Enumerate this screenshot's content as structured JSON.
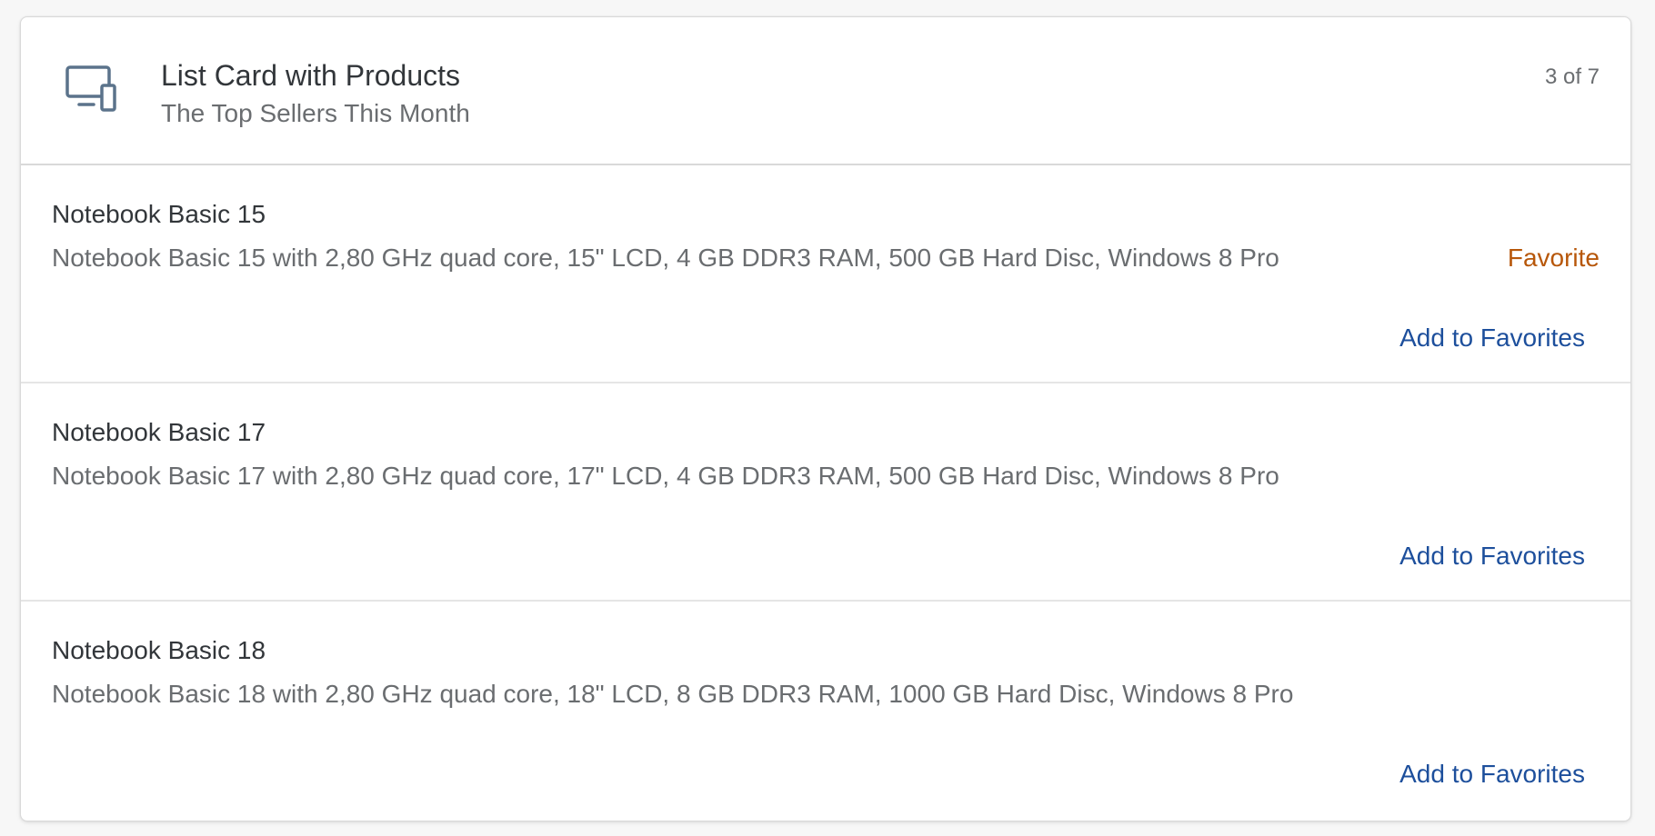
{
  "card": {
    "title": "List Card with Products",
    "subtitle": "The Top Sellers This Month",
    "count": "3 of 7",
    "icon": "laptop-tablet-icon",
    "colors": {
      "icon": "#5b738b",
      "status_favorite": "#b7570a",
      "link": "#1d4f9c"
    }
  },
  "items": [
    {
      "title": "Notebook Basic 15",
      "description": "Notebook Basic 15 with 2,80 GHz quad core, 15\" LCD, 4 GB DDR3 RAM, 500 GB Hard Disc, Windows 8 Pro",
      "status": "Favorite",
      "action": "Add to Favorites"
    },
    {
      "title": "Notebook Basic 17",
      "description": "Notebook Basic 17 with 2,80 GHz quad core, 17\" LCD, 4 GB DDR3 RAM, 500 GB Hard Disc, Windows 8 Pro",
      "status": "",
      "action": "Add to Favorites"
    },
    {
      "title": "Notebook Basic 18",
      "description": "Notebook Basic 18 with 2,80 GHz quad core, 18\" LCD, 8 GB DDR3 RAM, 1000 GB Hard Disc, Windows 8 Pro",
      "status": "",
      "action": "Add to Favorites"
    }
  ]
}
